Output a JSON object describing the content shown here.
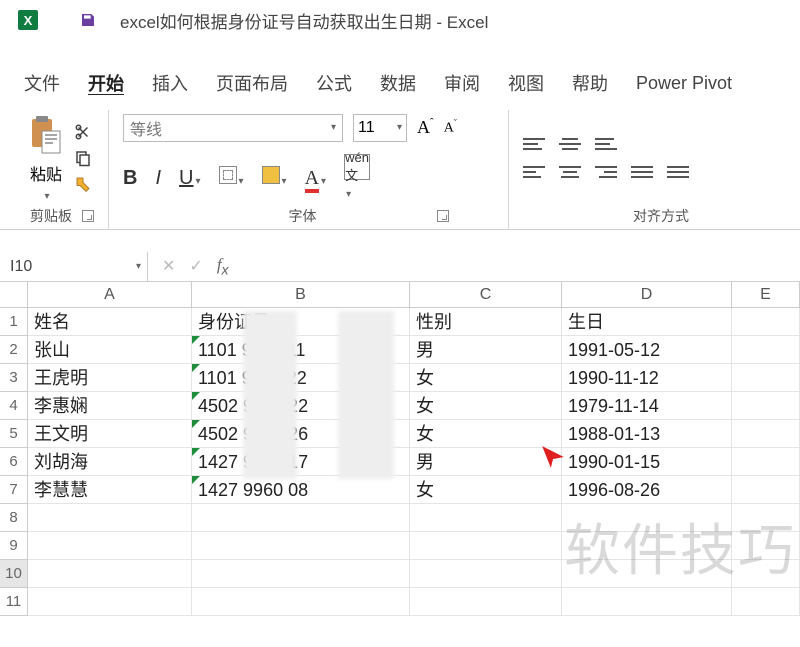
{
  "titlebar": {
    "doc_title": "excel如何根据身份证号自动获取出生日期 - Excel"
  },
  "tabs": {
    "file": "文件",
    "home": "开始",
    "insert": "插入",
    "layout": "页面布局",
    "formula": "公式",
    "data": "数据",
    "review": "审阅",
    "view": "视图",
    "help": "帮助",
    "powerpivot": "Power Pivot"
  },
  "ribbon": {
    "clipboard": {
      "paste": "粘贴",
      "group_label": "剪贴板"
    },
    "font": {
      "name": "等线",
      "size": "11",
      "group_label": "字体"
    },
    "align": {
      "group_label": "对齐方式"
    }
  },
  "namebox": "I10",
  "headers": {
    "A": "A",
    "B": "B",
    "C": "C",
    "D": "D",
    "E": "E"
  },
  "rows": [
    {
      "n": "1",
      "A": "姓名",
      "B": "身份证号",
      "C": "性别",
      "D": "生日",
      "tri": false
    },
    {
      "n": "2",
      "A": "张山",
      "B": "1101      9910        11",
      "C": "男",
      "D": "1991-05-12",
      "tri": true
    },
    {
      "n": "3",
      "A": "王虎明",
      "B": "1101      9901        22",
      "C": "女",
      "D": "1990-11-12",
      "tri": true
    },
    {
      "n": "4",
      "A": "李惠娴",
      "B": "4502      9791        22",
      "C": "女",
      "D": "1979-11-14",
      "tri": true
    },
    {
      "n": "5",
      "A": "王文明",
      "B": "4502      9880        26",
      "C": "女",
      "D": "1988-01-13",
      "tri": true
    },
    {
      "n": "6",
      "A": "刘胡海",
      "B": "1427      9900        17",
      "C": "男",
      "D": "1990-01-15",
      "tri": true
    },
    {
      "n": "7",
      "A": "李慧慧",
      "B": "1427      9960        08",
      "C": "女",
      "D": "1996-08-26",
      "tri": true
    },
    {
      "n": "8",
      "A": "",
      "B": "",
      "C": "",
      "D": "",
      "tri": false
    },
    {
      "n": "9",
      "A": "",
      "B": "",
      "C": "",
      "D": "",
      "tri": false
    },
    {
      "n": "10",
      "A": "",
      "B": "",
      "C": "",
      "D": "",
      "tri": false
    },
    {
      "n": "11",
      "A": "",
      "B": "",
      "C": "",
      "D": "",
      "tri": false
    }
  ],
  "watermark": "软件技巧"
}
